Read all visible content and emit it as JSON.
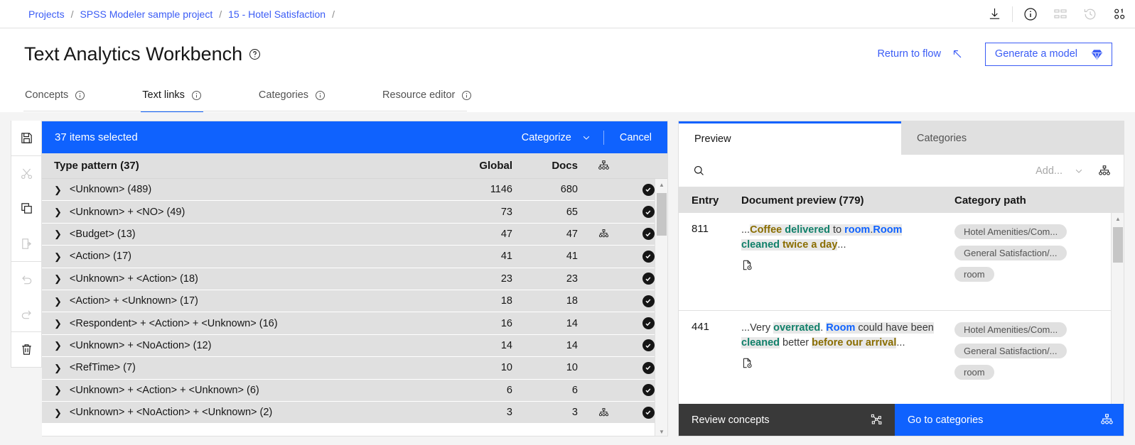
{
  "breadcrumb": {
    "items": [
      {
        "label": "Projects"
      },
      {
        "label": "SPSS Modeler sample project"
      },
      {
        "label": "15 - Hotel Satisfaction"
      }
    ],
    "separator": "/",
    "icons": [
      {
        "name": "download-icon"
      },
      {
        "name": "info-icon"
      },
      {
        "name": "sitemap-icon"
      },
      {
        "name": "history-icon"
      },
      {
        "name": "data-bits-icon"
      }
    ]
  },
  "header": {
    "title": "Text Analytics Workbench",
    "help_icon": "help-icon",
    "return_to_flow": "Return to flow",
    "return_icon": "arrow-up-left-icon",
    "generate_model": "Generate a model",
    "generate_icon": "gem-icon",
    "accent": "#0f62fe",
    "link_color": "#3b5cf5"
  },
  "tabs": [
    {
      "label": "Concepts",
      "active": false
    },
    {
      "label": "Text links",
      "active": true
    },
    {
      "label": "Categories",
      "active": false
    },
    {
      "label": "Resource editor",
      "active": false
    }
  ],
  "toolbar": {
    "items": [
      {
        "name": "save-icon",
        "disabled": false
      },
      {
        "name": "cut-icon",
        "disabled": true
      },
      {
        "name": "copy-icon",
        "disabled": false
      },
      {
        "name": "paste-icon",
        "disabled": true
      },
      {
        "name": "undo-icon",
        "disabled": true
      },
      {
        "name": "redo-icon",
        "disabled": true
      },
      {
        "name": "delete-icon",
        "disabled": false
      }
    ]
  },
  "selection_bar": {
    "count_label": "37 items selected",
    "categorize_label": "Categorize",
    "cancel_label": "Cancel"
  },
  "table": {
    "columns": {
      "pattern": "Type pattern (37)",
      "global": "Global",
      "docs": "Docs",
      "hierarchy_icon": "sitemap-icon"
    },
    "rows": [
      {
        "pattern": "<Unknown> (489)",
        "global": "1146",
        "docs": "680",
        "has_icon": false,
        "checked": true
      },
      {
        "pattern": "<Unknown> + <NO> (49)",
        "global": "73",
        "docs": "65",
        "has_icon": false,
        "checked": true
      },
      {
        "pattern": "<Budget> (13)",
        "global": "47",
        "docs": "47",
        "has_icon": true,
        "checked": true
      },
      {
        "pattern": "<Action> (17)",
        "global": "41",
        "docs": "41",
        "has_icon": false,
        "checked": true
      },
      {
        "pattern": "<Unknown> + <Action> (18)",
        "global": "23",
        "docs": "23",
        "has_icon": false,
        "checked": true
      },
      {
        "pattern": "<Action> + <Unknown> (17)",
        "global": "18",
        "docs": "18",
        "has_icon": false,
        "checked": true
      },
      {
        "pattern": "<Respondent> + <Action> + <Unknown> (16)",
        "global": "16",
        "docs": "14",
        "has_icon": false,
        "checked": true
      },
      {
        "pattern": "<Unknown> + <NoAction> (12)",
        "global": "14",
        "docs": "14",
        "has_icon": false,
        "checked": true
      },
      {
        "pattern": "<RefTime> (7)",
        "global": "10",
        "docs": "10",
        "has_icon": false,
        "checked": true
      },
      {
        "pattern": "<Unknown> + <Action> + <Unknown> (6)",
        "global": "6",
        "docs": "6",
        "has_icon": false,
        "checked": true
      },
      {
        "pattern": "<Unknown> + <NoAction> + <Unknown> (2)",
        "global": "3",
        "docs": "3",
        "has_icon": true,
        "checked": true
      }
    ]
  },
  "preview_panel": {
    "tabs": [
      {
        "label": "Preview",
        "active": true
      },
      {
        "label": "Categories",
        "active": false
      }
    ],
    "search_icon": "search-icon",
    "search_value": "",
    "search_placeholder": "",
    "add_label": "Add...",
    "add_chevron": "chevron-down-icon",
    "hierarchy_icon": "sitemap-icon",
    "columns": {
      "entry": "Entry",
      "document_preview": "Document preview (779)",
      "category_path": "Category path"
    },
    "rows": [
      {
        "entry": "811",
        "tokens": [
          {
            "text": "...",
            "style": "plain",
            "hl": false
          },
          {
            "text": "Coffee",
            "style": "olive",
            "hl": true
          },
          {
            "text": " ",
            "style": "plain",
            "hl": true
          },
          {
            "text": "delivered",
            "style": "verb",
            "hl": true
          },
          {
            "text": " to ",
            "style": "plain",
            "hl": true
          },
          {
            "text": "room",
            "style": "concept",
            "hl": true
          },
          {
            "text": ".",
            "style": "plain",
            "hl": true
          },
          {
            "text": "Room",
            "style": "concept",
            "hl": true
          },
          {
            "text": " ",
            "style": "plain",
            "hl": true
          },
          {
            "text": "cleaned",
            "style": "verb",
            "hl": true
          },
          {
            "text": " ",
            "style": "plain",
            "hl": true
          },
          {
            "text": "twice a day",
            "style": "olive",
            "hl": true
          },
          {
            "text": "...",
            "style": "plain",
            "hl": false
          }
        ],
        "doc_icon": "document-view-icon",
        "categories": [
          "Hotel Amenities/Com...",
          "General Satisfaction/...",
          "room"
        ]
      },
      {
        "entry": "441",
        "tokens": [
          {
            "text": "...",
            "style": "plain",
            "hl": false
          },
          {
            "text": "Very ",
            "style": "plain",
            "hl": false
          },
          {
            "text": "overrated",
            "style": "verb",
            "hl": true
          },
          {
            "text": ". ",
            "style": "plain",
            "hl": false
          },
          {
            "text": "Room",
            "style": "concept",
            "hl": true
          },
          {
            "text": " could have been ",
            "style": "plain",
            "hl": true
          },
          {
            "text": "cleaned",
            "style": "verb",
            "hl": true
          },
          {
            "text": " better ",
            "style": "plain",
            "hl": false
          },
          {
            "text": "before our arrival",
            "style": "olive",
            "hl": true
          },
          {
            "text": "...",
            "style": "plain",
            "hl": false
          }
        ],
        "doc_icon": "document-view-icon",
        "categories": [
          "Hotel Amenities/Com...",
          "General Satisfaction/...",
          "room"
        ]
      }
    ],
    "footer": {
      "review_label": "Review concepts",
      "review_icon": "concept-map-icon",
      "go_label": "Go to categories",
      "go_icon": "sitemap-icon"
    }
  },
  "colors": {
    "blue": "#0f62fe",
    "link": "#3b5cf5",
    "dark": "#393939",
    "row_bg": "#e0e0e0",
    "concept_token": "#0f62fe",
    "verb_token": "#11806a",
    "olive_token": "#8a6d00"
  }
}
